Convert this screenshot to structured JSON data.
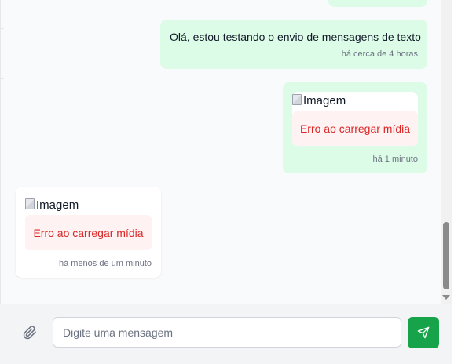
{
  "messages": [
    {
      "direction": "outgoing",
      "type": "text",
      "text": "Olá, estou testando o envio de mensagens de texto",
      "time": "há cerca de 4 horas"
    },
    {
      "direction": "outgoing",
      "type": "media",
      "image_alt": "Imagem",
      "error": "Erro ao carregar mídia",
      "time": "há 1 minuto"
    },
    {
      "direction": "incoming",
      "type": "media",
      "image_alt": "Imagem",
      "error": "Erro ao carregar mídia",
      "time": "há menos de um minuto"
    }
  ],
  "composer": {
    "placeholder": "Digite uma mensagem",
    "value": "",
    "attach_icon": "paperclip-icon",
    "send_icon": "send-icon"
  },
  "colors": {
    "outgoing_bubble": "#dcfce7",
    "incoming_bubble": "#ffffff",
    "error_text": "#dc2626",
    "error_bg": "#fef2f2",
    "send_button": "#16a34a"
  }
}
